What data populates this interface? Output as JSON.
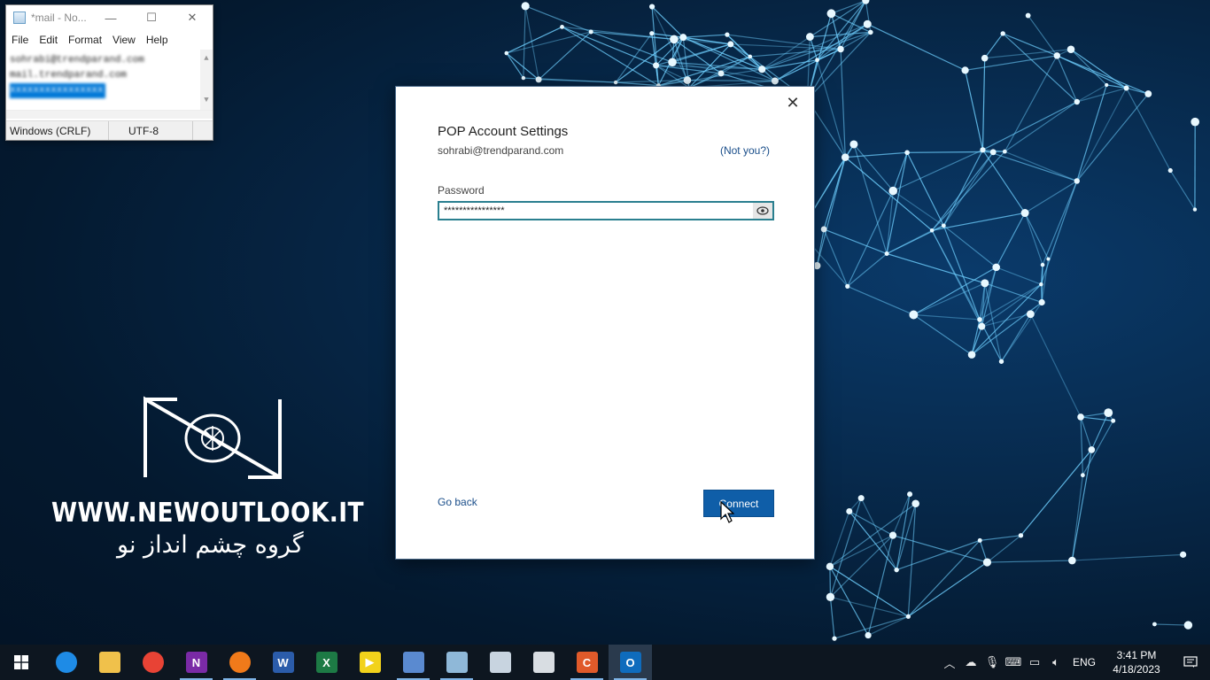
{
  "notepad": {
    "title": "*mail - No...",
    "menu": [
      "File",
      "Edit",
      "Format",
      "View",
      "Help"
    ],
    "lines": [
      "sohrabi@trendparand.com",
      "mail.trendparand.com",
      "xxxxxxxxxxxxxxxx"
    ],
    "status_crlf": "Windows (CRLF)",
    "status_encoding": "UTF-8"
  },
  "dialog": {
    "title": "POP Account Settings",
    "email": "sohrabi@trendparand.com",
    "not_you": "(Not you?)",
    "password_label": "Password",
    "password_value": "****************",
    "go_back": "Go back",
    "connect": "Connect"
  },
  "logo": {
    "url": "WWW.NEWOUTLOOK.IT",
    "persian": "گروه چشم انداز نو"
  },
  "taskbar": {
    "apps": [
      {
        "name": "edge",
        "label": "",
        "color": "#1e8be6",
        "running": false
      },
      {
        "name": "file-explorer",
        "label": "",
        "color": "#f0c14b",
        "running": false
      },
      {
        "name": "chrome",
        "label": "",
        "color": "#e84335",
        "running": false
      },
      {
        "name": "onenote",
        "label": "N",
        "color": "#7a2aa6",
        "running": true
      },
      {
        "name": "firefox",
        "label": "",
        "color": "#f07a1a",
        "running": true
      },
      {
        "name": "word",
        "label": "W",
        "color": "#2b5caa",
        "running": false
      },
      {
        "name": "excel",
        "label": "X",
        "color": "#1d7a45",
        "running": false
      },
      {
        "name": "kmplayer",
        "label": "▶",
        "color": "#f2d21b",
        "running": false
      },
      {
        "name": "network-tool",
        "label": "",
        "color": "#5a8ad0",
        "running": true
      },
      {
        "name": "notepad",
        "label": "",
        "color": "#8fb8d8",
        "running": true
      },
      {
        "name": "snipping-tool",
        "label": "",
        "color": "#c8d4e0",
        "running": false
      },
      {
        "name": "screen-recorder",
        "label": "",
        "color": "#d8dde2",
        "running": false
      },
      {
        "name": "camtasia",
        "label": "C",
        "color": "#e05a2a",
        "running": true
      },
      {
        "name": "outlook",
        "label": "O",
        "color": "#0f6cbd",
        "running": true,
        "active": true
      }
    ],
    "language": "ENG",
    "time": "3:41 PM",
    "date": "4/18/2023"
  }
}
